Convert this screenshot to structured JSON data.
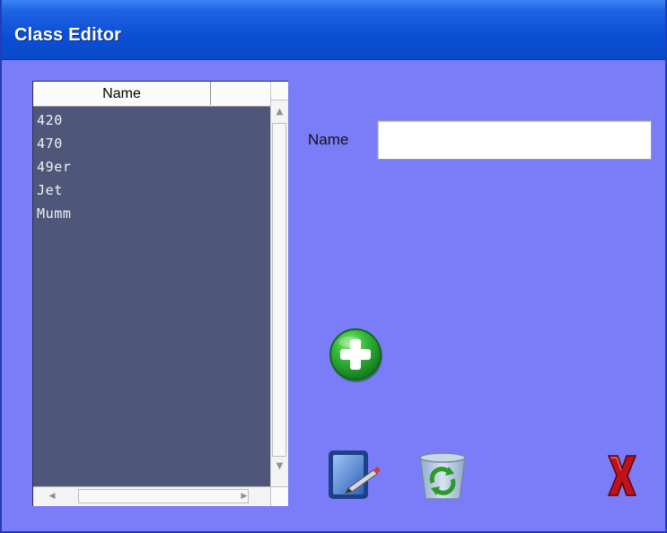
{
  "window": {
    "title": "Class Editor"
  },
  "list": {
    "header": {
      "name_column": "Name"
    },
    "items": [
      {
        "label": "420"
      },
      {
        "label": "470"
      },
      {
        "label": "49er"
      },
      {
        "label": "Jet"
      },
      {
        "label": "Mumm"
      }
    ]
  },
  "form": {
    "name_label": "Name",
    "name_value": ""
  },
  "toolbar": {
    "add_icon": "add-plus-icon",
    "edit_icon": "edit-pencil-icon",
    "refresh_icon": "recycle-refresh-icon",
    "close_icon": "red-x-close-icon"
  },
  "colors": {
    "title_bar": "#0b4fd6",
    "background": "#7b7cf7",
    "list_background": "#4e577a",
    "add_green": "#2aa13a",
    "close_red": "#c0121a"
  }
}
